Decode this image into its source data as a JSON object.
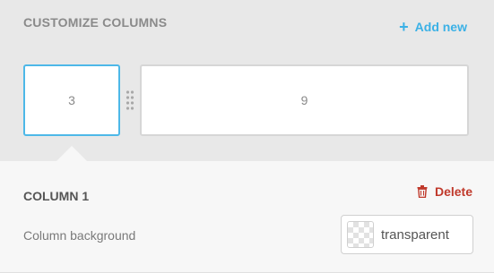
{
  "header": {
    "title": "CUSTOMIZE COLUMNS",
    "add_new_label": "Add new",
    "add_icon": "plus-icon"
  },
  "columns": [
    {
      "label": "3",
      "selected": true
    },
    {
      "label": "9",
      "selected": false
    }
  ],
  "column_settings": {
    "title": "COLUMN 1",
    "delete_label": "Delete",
    "delete_icon": "trash-icon",
    "background_label": "Column background",
    "background_value": "transparent",
    "background_swatch_icon": "checkerboard-swatch-icon"
  },
  "colors": {
    "accent": "#3bb1e6",
    "selected_border": "#4db8e8",
    "delete": "#c0392b",
    "panel_bg": "#e8e8e8",
    "content_bg": "#f7f7f7"
  }
}
